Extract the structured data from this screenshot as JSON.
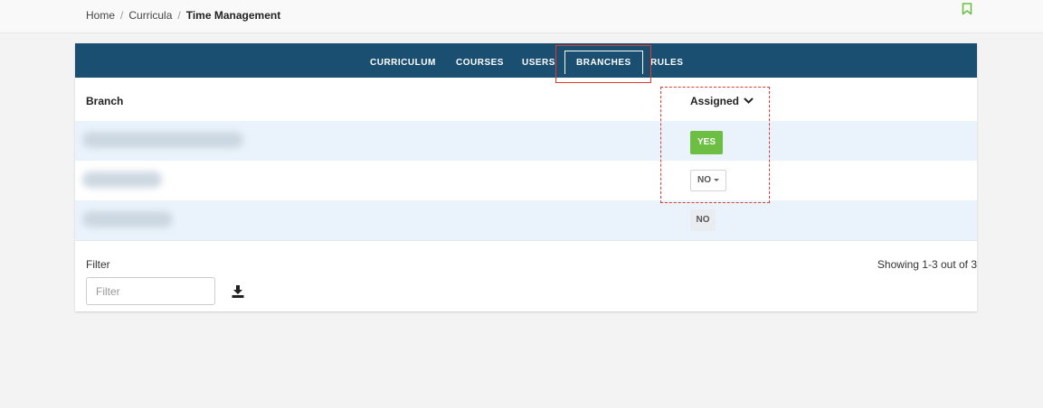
{
  "breadcrumb": {
    "home": "Home",
    "separator": "/",
    "curricula": "Curricula",
    "current": "Time Management"
  },
  "icons": {
    "bookmark": "bookmark-icon",
    "sort": "chevron-down-icon",
    "download": "download-icon"
  },
  "colors": {
    "tab_bar": "#1b4f72",
    "yes_button": "#6cbf43",
    "bookmark": "#6cbf43",
    "row_alt": "#eaf3fb",
    "annotation": "#e23b2e"
  },
  "tabs": [
    {
      "label": "CURRICULUM"
    },
    {
      "label": "COURSES"
    },
    {
      "label": "USERS"
    },
    {
      "label": "BRANCHES"
    },
    {
      "label": "RULES"
    }
  ],
  "active_tab": "BRANCHES",
  "table": {
    "headers": {
      "branch": "Branch",
      "assigned": "Assigned"
    },
    "rows": [
      {
        "branch": "",
        "assigned": "YES"
      },
      {
        "branch": "",
        "assigned": "NO"
      },
      {
        "branch": "",
        "assigned": "NO"
      }
    ]
  },
  "filter": {
    "label": "Filter",
    "placeholder": "Filter",
    "value": ""
  },
  "pagination": {
    "showing": "Showing 1-3 out of 3"
  }
}
